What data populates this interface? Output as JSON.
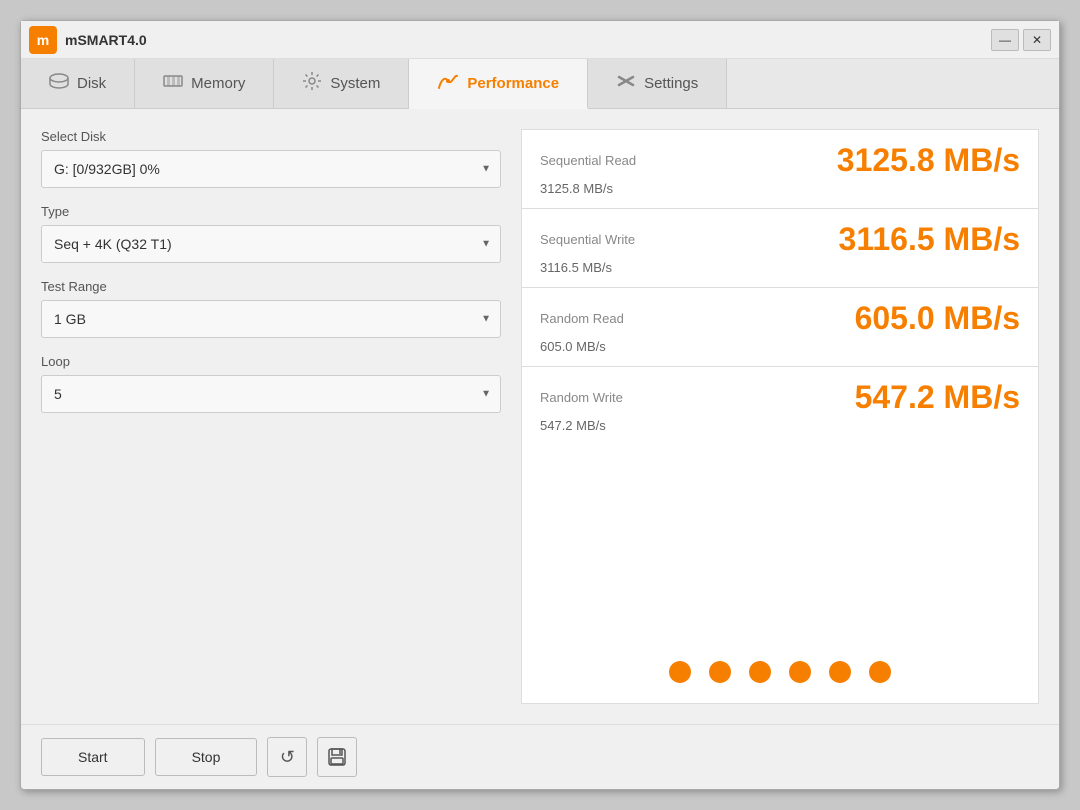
{
  "window": {
    "title": "mSMART4.0",
    "logo_text": "m",
    "minimize_label": "—",
    "close_label": "✕"
  },
  "tabs": [
    {
      "id": "disk",
      "label": "Disk",
      "icon": "💾",
      "active": false
    },
    {
      "id": "memory",
      "label": "Memory",
      "icon": "📦",
      "active": false
    },
    {
      "id": "system",
      "label": "System",
      "icon": "⚙️",
      "active": false
    },
    {
      "id": "performance",
      "label": "Performance",
      "icon": "🔄",
      "active": true
    },
    {
      "id": "settings",
      "label": "Settings",
      "icon": "✖",
      "active": false
    }
  ],
  "left": {
    "select_disk_label": "Select Disk",
    "select_disk_value": "G: [0/932GB] 0%",
    "type_label": "Type",
    "type_value": "Seq + 4K (Q32 T1)",
    "test_range_label": "Test Range",
    "test_range_value": "1 GB",
    "loop_label": "Loop",
    "loop_value": "5"
  },
  "metrics": [
    {
      "name": "Sequential Read",
      "value_large": "3125.8 MB/s",
      "value_small": "3125.8 MB/s"
    },
    {
      "name": "Sequential Write",
      "value_large": "3116.5 MB/s",
      "value_small": "3116.5 MB/s"
    },
    {
      "name": "Random Read",
      "value_large": "605.0 MB/s",
      "value_small": "605.0 MB/s"
    },
    {
      "name": "Random Write",
      "value_large": "547.2 MB/s",
      "value_small": "547.2 MB/s"
    }
  ],
  "dots_count": 6,
  "buttons": {
    "start": "Start",
    "stop": "Stop",
    "refresh_icon": "↺",
    "save_icon": "💾"
  }
}
